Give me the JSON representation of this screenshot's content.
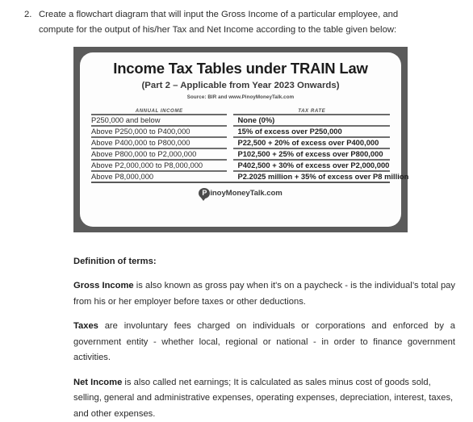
{
  "question": {
    "number": "2.",
    "line1": "Create a flowchart diagram that will input the Gross Income of a particular employee, and",
    "line2": "compute for the output of his/her Tax and Net Income according to the table given below:"
  },
  "tax_table_figure": {
    "title": "Income Tax Tables under TRAIN Law",
    "subtitle": "(Part 2 – Applicable from Year 2023 Onwards)",
    "source": "Source: BIR and www.PinoyMoneyTalk.com",
    "columns": [
      "ANNUAL INCOME",
      "TAX RATE"
    ],
    "rows": [
      {
        "income": "P250,000 and below",
        "rate": "None (0%)"
      },
      {
        "income": "Above P250,000 to P400,000",
        "rate": "15% of excess over P250,000"
      },
      {
        "income": "Above P400,000 to P800,000",
        "rate": "P22,500 + 20% of excess over P400,000"
      },
      {
        "income": "Above P800,000 to P2,000,000",
        "rate": "P102,500 + 25% of excess over P800,000"
      },
      {
        "income": "Above P2,000,000 to P8,000,000",
        "rate": "P402,500 + 30% of excess over P2,000,000"
      },
      {
        "income": "Above P8,000,000",
        "rate": "P2.2025 million + 35% of excess over P8 million"
      }
    ],
    "logo": {
      "mark_letter": "P",
      "text": "inoyMoneyTalk.com"
    },
    "colors": {
      "frame": "#5b5b5b",
      "card": "#fdfdfd",
      "rule": "#6f6f6f"
    }
  },
  "definitions": {
    "heading": "Definition of terms:",
    "items": [
      {
        "term": "Gross Income",
        "text": " is also known as gross pay when it's on a paycheck - is the individual’s total pay from his or her employer before taxes or other deductions."
      },
      {
        "term": "Taxes",
        "text": " are involuntary fees charged on individuals or corporations and enforced by a government entity - whether local, regional or national - in order to finance government activities."
      },
      {
        "term": "Net Income",
        "text": " is also called net earnings; It is calculated as sales minus cost of goods sold, selling, general and administrative expenses, operating expenses, depreciation, interest, taxes, and other expenses."
      }
    ]
  }
}
